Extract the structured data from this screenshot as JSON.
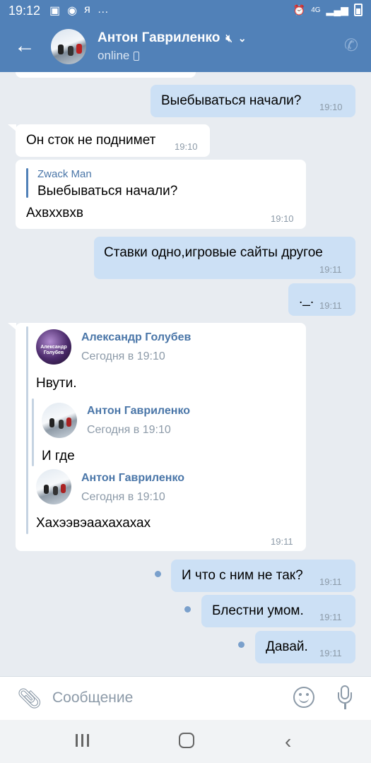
{
  "status_bar": {
    "time": "19:12",
    "left_icons": [
      "image-icon",
      "app-icon",
      "я",
      "…"
    ],
    "right_icons": [
      "alarm-icon",
      "4G",
      "signal-icon",
      "battery-icon"
    ]
  },
  "header": {
    "contact_name": "Антон Гавриленко",
    "status": "online",
    "muted": true
  },
  "messages": [
    {
      "direction": "out",
      "text": "Выебываться начали?",
      "time": "19:10"
    },
    {
      "direction": "in",
      "text": "Он сток не поднимет",
      "time": "19:10"
    },
    {
      "direction": "in",
      "reply_author": "Zwack Man",
      "reply_text": "Выебываться начали?",
      "text": "Ахвххвхв",
      "time": "19:10"
    },
    {
      "direction": "out",
      "text": "Ставки одно,игровые сайты другое",
      "time": "19:11"
    },
    {
      "direction": "out",
      "text": "._.",
      "time": "19:11"
    },
    {
      "direction": "in",
      "time": "19:11",
      "forwarded": [
        {
          "author": "Александр Голубев",
          "date": "Сегодня в 19:10",
          "text": "Нвути.",
          "nested": {
            "author": "Антон Гавриленко",
            "date": "Сегодня в 19:10",
            "text": "И где"
          }
        },
        {
          "author": "Антон Гавриленко",
          "date": "Сегодня в 19:10",
          "text": "Хахээвэаахахахах"
        }
      ]
    },
    {
      "direction": "out",
      "text": "И что с ним не так?",
      "time": "19:11",
      "unread": true
    },
    {
      "direction": "out",
      "text": "Блестни умом.",
      "time": "19:11",
      "unread": true
    },
    {
      "direction": "out",
      "text": "Давай.",
      "time": "19:11",
      "unread": true
    }
  ],
  "avatar_label": "Александр Голубев",
  "input": {
    "placeholder": "Сообщение"
  },
  "colors": {
    "header": "#5181b8",
    "outgoing": "#cce0f5",
    "incoming": "#ffffff",
    "background": "#e8ecf1",
    "link": "#4a76a8"
  }
}
